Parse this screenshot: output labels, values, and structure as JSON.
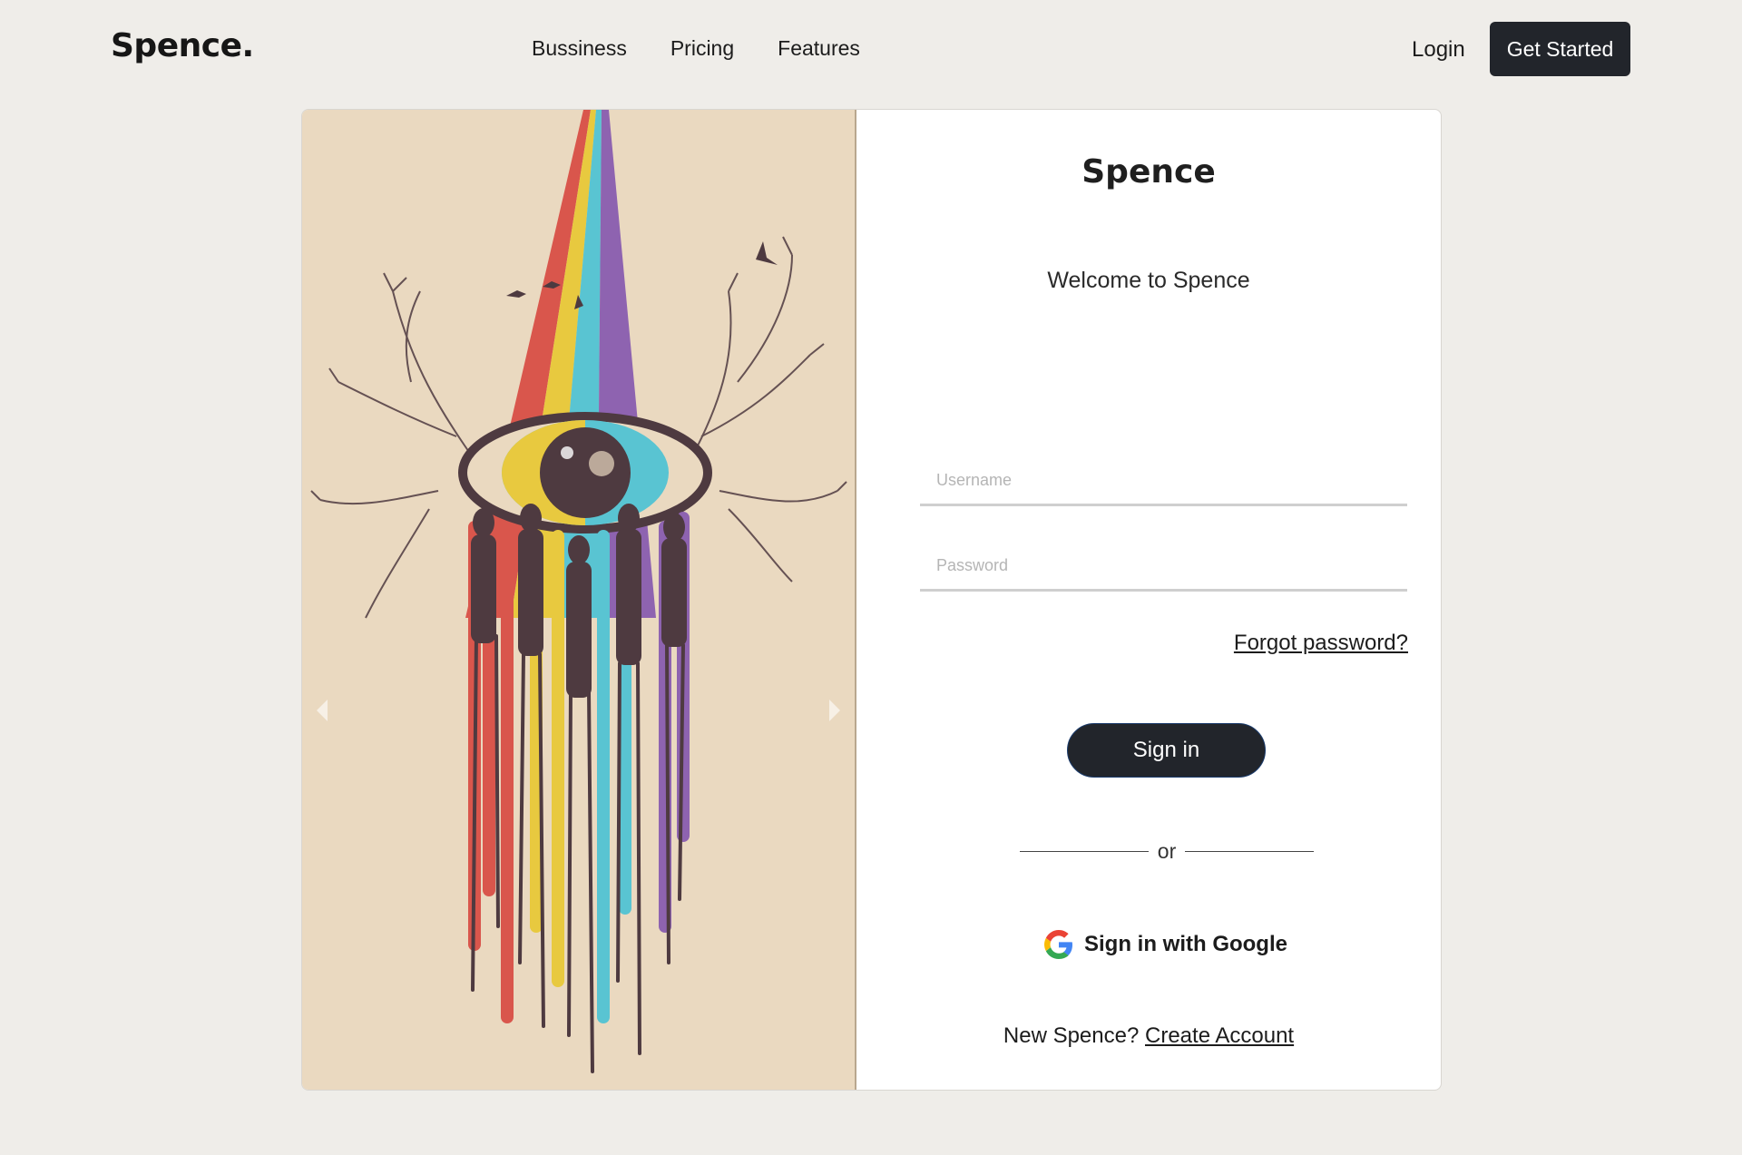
{
  "nav": {
    "brand": "Spence.",
    "links": [
      "Bussiness",
      "Pricing",
      "Features"
    ],
    "login": "Login",
    "cta": "Get Started"
  },
  "carousel": {
    "slide_count": 4,
    "active_slide": 1
  },
  "form": {
    "title": "Spence",
    "welcome": "Welcome to Spence",
    "username_placeholder": "Username",
    "password_placeholder": "Password",
    "forgot": "Forgot password?",
    "signin": "Sign in",
    "divider": "or",
    "google": "Sign in with Google",
    "new_prompt": "New Spence?",
    "create": "Create Account"
  },
  "colors": {
    "background": "#efede9",
    "dark_button": "#22252b",
    "art_background": "#ead9c0"
  }
}
